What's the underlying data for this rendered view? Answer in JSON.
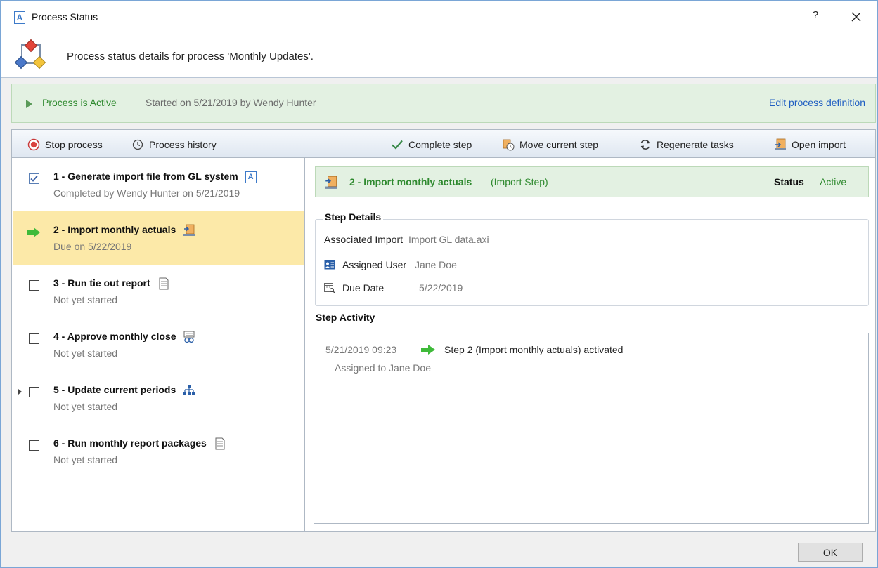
{
  "window": {
    "title": "Process Status",
    "title_icon_letter": "A",
    "help_label": "?",
    "close_icon": "close-icon"
  },
  "header": {
    "description": "Process status details for process 'Monthly Updates'."
  },
  "status": {
    "state": "Process is Active",
    "started": "Started on 5/21/2019 by Wendy Hunter",
    "edit_link": "Edit process definition"
  },
  "toolbar": {
    "stop": "Stop process",
    "history": "Process history",
    "complete": "Complete step",
    "move": "Move current step",
    "regenerate": "Regenerate tasks",
    "open_import": "Open import"
  },
  "steps": [
    {
      "title": "1 - Generate import file from GL system",
      "sub": "Completed by Wendy Hunter on 5/21/2019",
      "state": "completed",
      "type_icon": "axiom-file-icon"
    },
    {
      "title": "2 - Import monthly actuals",
      "sub": "Due on 5/22/2019",
      "state": "active",
      "type_icon": "import-icon"
    },
    {
      "title": "3 - Run tie out report",
      "sub": "Not yet started",
      "state": "pending",
      "type_icon": "report-icon"
    },
    {
      "title": "4 - Approve monthly close",
      "sub": "Not yet started",
      "state": "pending",
      "type_icon": "approval-icon"
    },
    {
      "title": "5 - Update current periods",
      "sub": "Not yet started",
      "state": "pending",
      "type_icon": "hierarchy-icon"
    },
    {
      "title": "6 - Run monthly report packages",
      "sub": "Not yet started",
      "state": "pending",
      "type_icon": "report-icon"
    }
  ],
  "step_header": {
    "title": "2 - Import monthly actuals",
    "type": "(Import Step)",
    "status_label": "Status",
    "status_value": "Active"
  },
  "step_details": {
    "legend": "Step Details",
    "associated_import_label": "Associated Import",
    "associated_import_value": "Import GL data.axi",
    "assigned_user_label": "Assigned User",
    "assigned_user_value": "Jane Doe",
    "due_date_label": "Due Date",
    "due_date_value": "5/22/2019"
  },
  "activity": {
    "label": "Step Activity",
    "entries": [
      {
        "time": "5/21/2019 09:23",
        "message": "Step 2 (Import monthly actuals) activated",
        "detail": "Assigned to Jane Doe"
      }
    ]
  },
  "footer": {
    "ok": "OK"
  },
  "colors": {
    "accent_green": "#2f8a2f",
    "status_bg": "#e3f1e2",
    "selected_row": "#fce9a8",
    "link_blue": "#1f5ec2",
    "window_border": "#7aa6d6"
  }
}
